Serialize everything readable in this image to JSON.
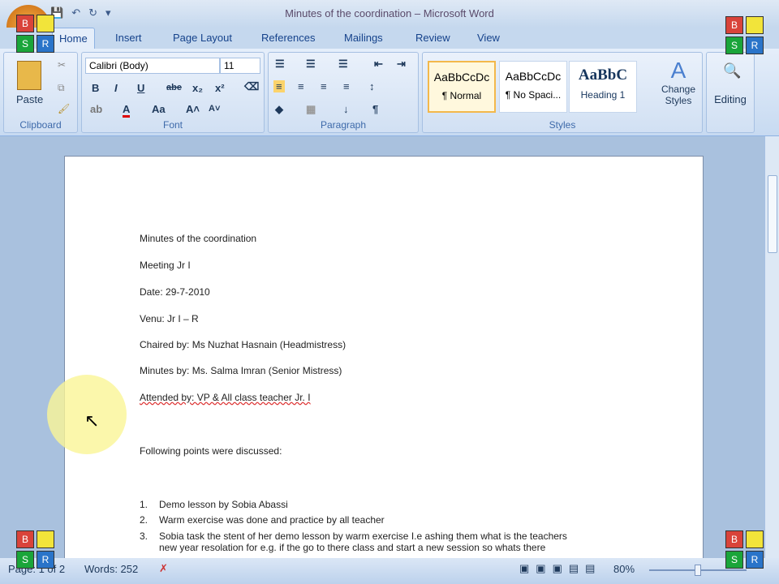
{
  "window": {
    "title": "Minutes of the coordination – Microsoft Word"
  },
  "qat": {
    "save": "💾",
    "undo": "↶",
    "redo": "↻",
    "more": "▾"
  },
  "tabs": [
    "Home",
    "Insert",
    "Page Layout",
    "References",
    "Mailings",
    "Review",
    "View"
  ],
  "ribbon": {
    "clipboard": {
      "label": "Clipboard",
      "paste": "Paste"
    },
    "font": {
      "label": "Font",
      "name": "Calibri (Body)",
      "size": "11",
      "bold": "B",
      "italic": "I",
      "underline": "U",
      "strike": "abe",
      "sub": "x₂",
      "sup": "x²",
      "case": "Aa",
      "grow": "A˄",
      "shrink": "A˅",
      "color": "A"
    },
    "paragraph": {
      "label": "Paragraph",
      "pilcrow": "¶"
    },
    "styles": {
      "label": "Styles",
      "items": [
        {
          "preview": "AaBbCcDc",
          "name": "¶ Normal"
        },
        {
          "preview": "AaBbCcDc",
          "name": "¶ No Spaci..."
        },
        {
          "preview": "AaBbC",
          "name": "Heading 1"
        }
      ],
      "change": "Change Styles"
    },
    "editing": {
      "label": "Editing"
    }
  },
  "document": {
    "lines": [
      "Minutes of the coordination",
      "Meeting Jr I",
      "Date: 29-7-2010",
      "Venu: Jr I – R",
      "Chaired by: Ms Nuzhat Hasnain (Headmistress)",
      "Minutes by: Ms. Salma Imran (Senior Mistress)",
      "Attended by: VP & All class teacher Jr. I",
      "Following points were discussed:"
    ],
    "items": [
      {
        "n": "1.",
        "text": "Demo lesson by Sobia Abassi"
      },
      {
        "n": "2.",
        "text": "Warm exercise was done and practice by all teacher"
      },
      {
        "n": "3.",
        "text": "Sobia task the stent of her demo lesson by warm exercise I.e ashing them what is the teachers",
        "cont": "new year resolation for e.g. if the go to there class and start a new session so whats there"
      }
    ]
  },
  "status": {
    "page": "Page: 1 of 2",
    "words": "Words: 252",
    "zoom": "80%"
  },
  "overlay": {
    "b": "B",
    "s": "S",
    "r": "R"
  }
}
